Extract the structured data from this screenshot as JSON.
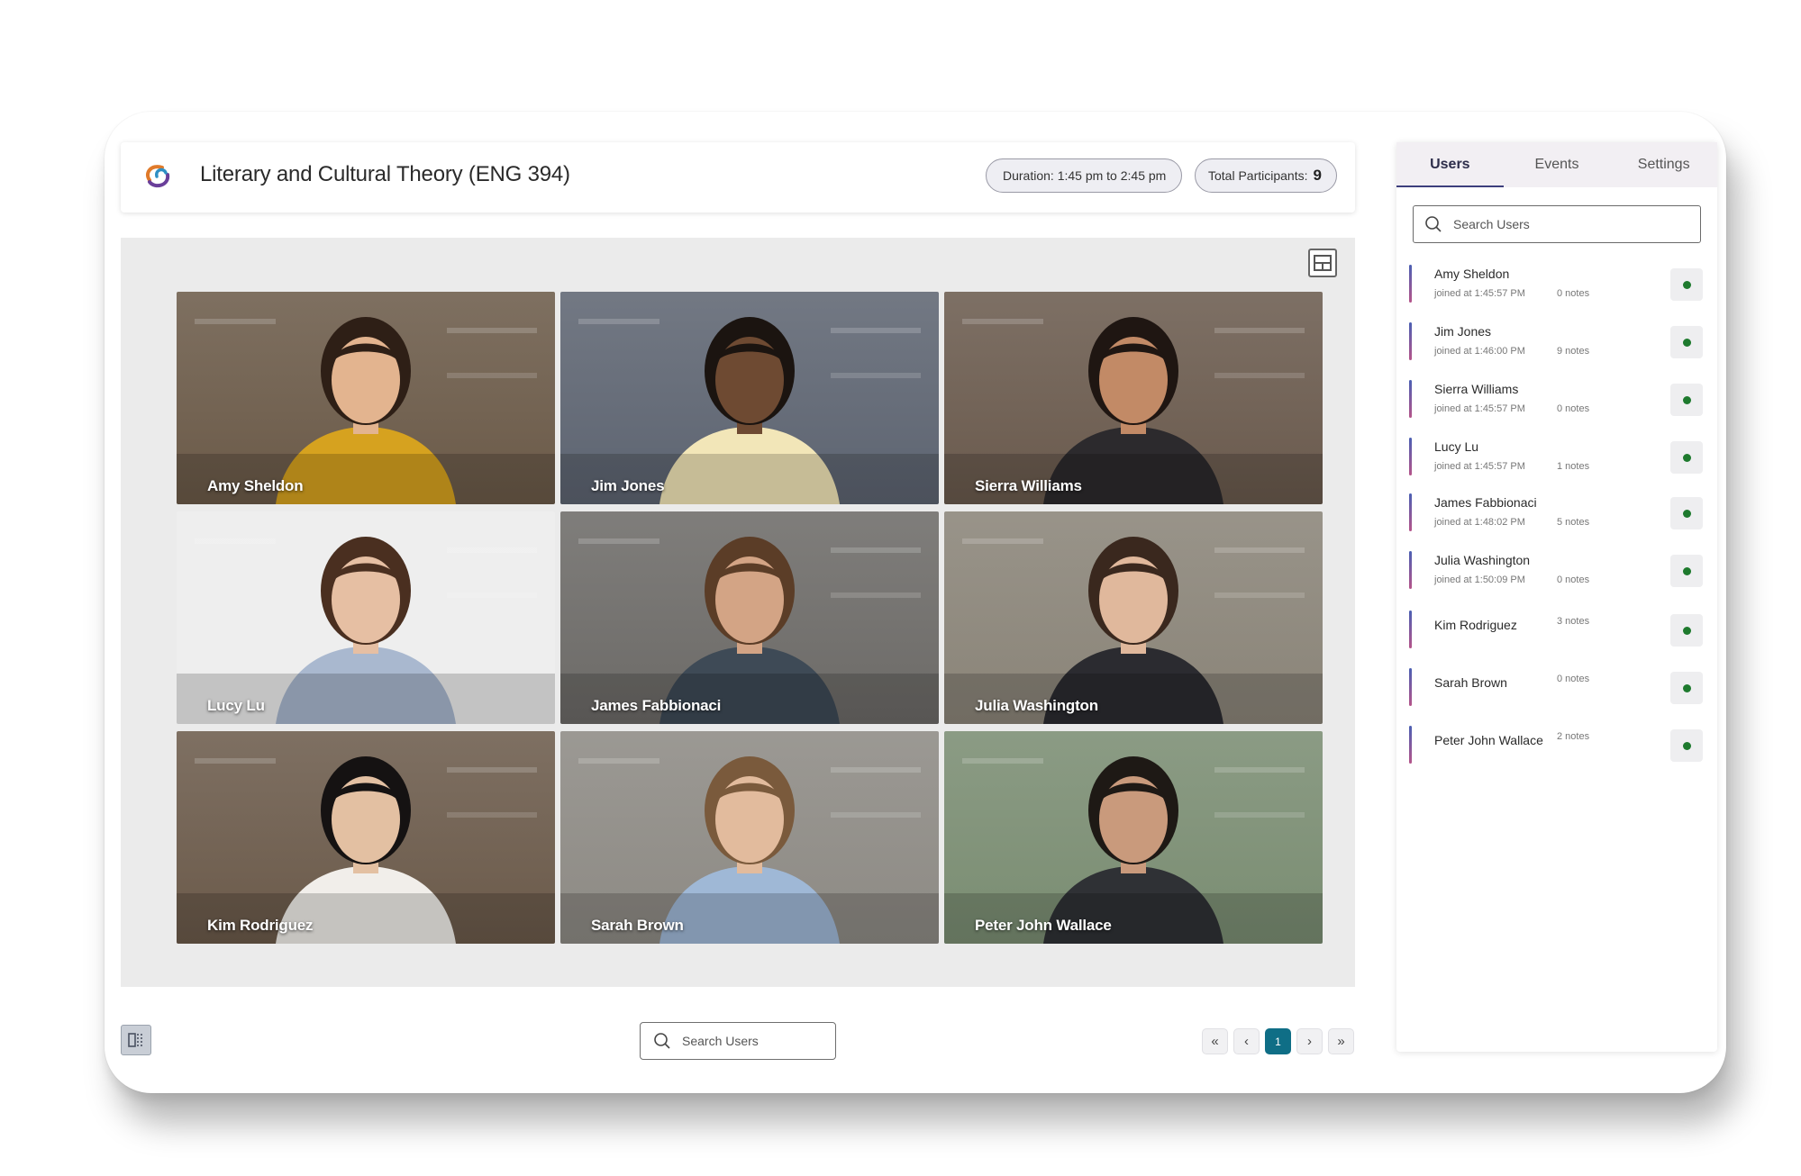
{
  "header": {
    "title": "Literary and Cultural Theory (ENG 394)",
    "duration": "Duration: 1:45 pm to 2:45 pm",
    "participants_label": "Total Participants:",
    "participants_count": "9"
  },
  "tiles": [
    {
      "name": "Amy Sheldon",
      "bg": "#6b5a48",
      "shirt": "#d6a21f",
      "skin": "#e3b48f",
      "hair": "#2e1f16"
    },
    {
      "name": "Jim Jones",
      "bg": "#5d6471",
      "shirt": "#f2e6b8",
      "skin": "#6e4a32",
      "hair": "#1b1410"
    },
    {
      "name": "Sierra Williams",
      "bg": "#6a5a4d",
      "shirt": "#2c2a2d",
      "skin": "#c28a66",
      "hair": "#1f1612"
    },
    {
      "name": "Lucy Lu",
      "bg": "#eeeeee",
      "shirt": "#a9b8cf",
      "skin": "#e6bfa3",
      "hair": "#4a2f20"
    },
    {
      "name": "James Fabbionaci",
      "bg": "#6c6a67",
      "shirt": "#3e4a56",
      "skin": "#d3a485",
      "hair": "#5b3d27"
    },
    {
      "name": "Julia Washington",
      "bg": "#8a8478",
      "shirt": "#2b2b30",
      "skin": "#e0b89c",
      "hair": "#3a281e"
    },
    {
      "name": "Kim Rodriguez",
      "bg": "#6b5a4a",
      "shirt": "#f1eeea",
      "skin": "#e3c0a2",
      "hair": "#151212"
    },
    {
      "name": "Sarah Brown",
      "bg": "#8d8a84",
      "shirt": "#9fb8d6",
      "skin": "#e2bb9d",
      "hair": "#7a5a3c"
    },
    {
      "name": "Peter John Wallace",
      "bg": "#7a8d72",
      "shirt": "#2f3135",
      "skin": "#c99a7c",
      "hair": "#1e1915"
    }
  ],
  "bottom": {
    "search_placeholder": "Search Users",
    "pages": [
      "«",
      "‹",
      "1",
      "›",
      "»"
    ]
  },
  "side": {
    "tabs": [
      "Users",
      "Events",
      "Settings"
    ],
    "search_placeholder": "Search Users",
    "users": [
      {
        "name": "Amy Sheldon",
        "joined": "joined at 1:45:57 PM",
        "notes": "0 notes"
      },
      {
        "name": "Jim Jones",
        "joined": "joined at 1:46:00 PM",
        "notes": "9 notes"
      },
      {
        "name": "Sierra Williams",
        "joined": "joined at 1:45:57 PM",
        "notes": "0 notes"
      },
      {
        "name": "Lucy Lu",
        "joined": "joined at 1:45:57 PM",
        "notes": "1 notes"
      },
      {
        "name": "James Fabbionaci",
        "joined": "joined at 1:48:02 PM",
        "notes": "5 notes"
      },
      {
        "name": "Julia Washington",
        "joined": "joined at 1:50:09 PM",
        "notes": "0 notes"
      },
      {
        "name": "Kim Rodriguez",
        "joined": "",
        "notes": "3 notes"
      },
      {
        "name": "Sarah Brown",
        "joined": "",
        "notes": "0 notes"
      },
      {
        "name": "Peter John Wallace",
        "joined": "",
        "notes": "2 notes"
      }
    ],
    "status_color": "#1e7a2e",
    "accent_color": "#0f6e86"
  }
}
